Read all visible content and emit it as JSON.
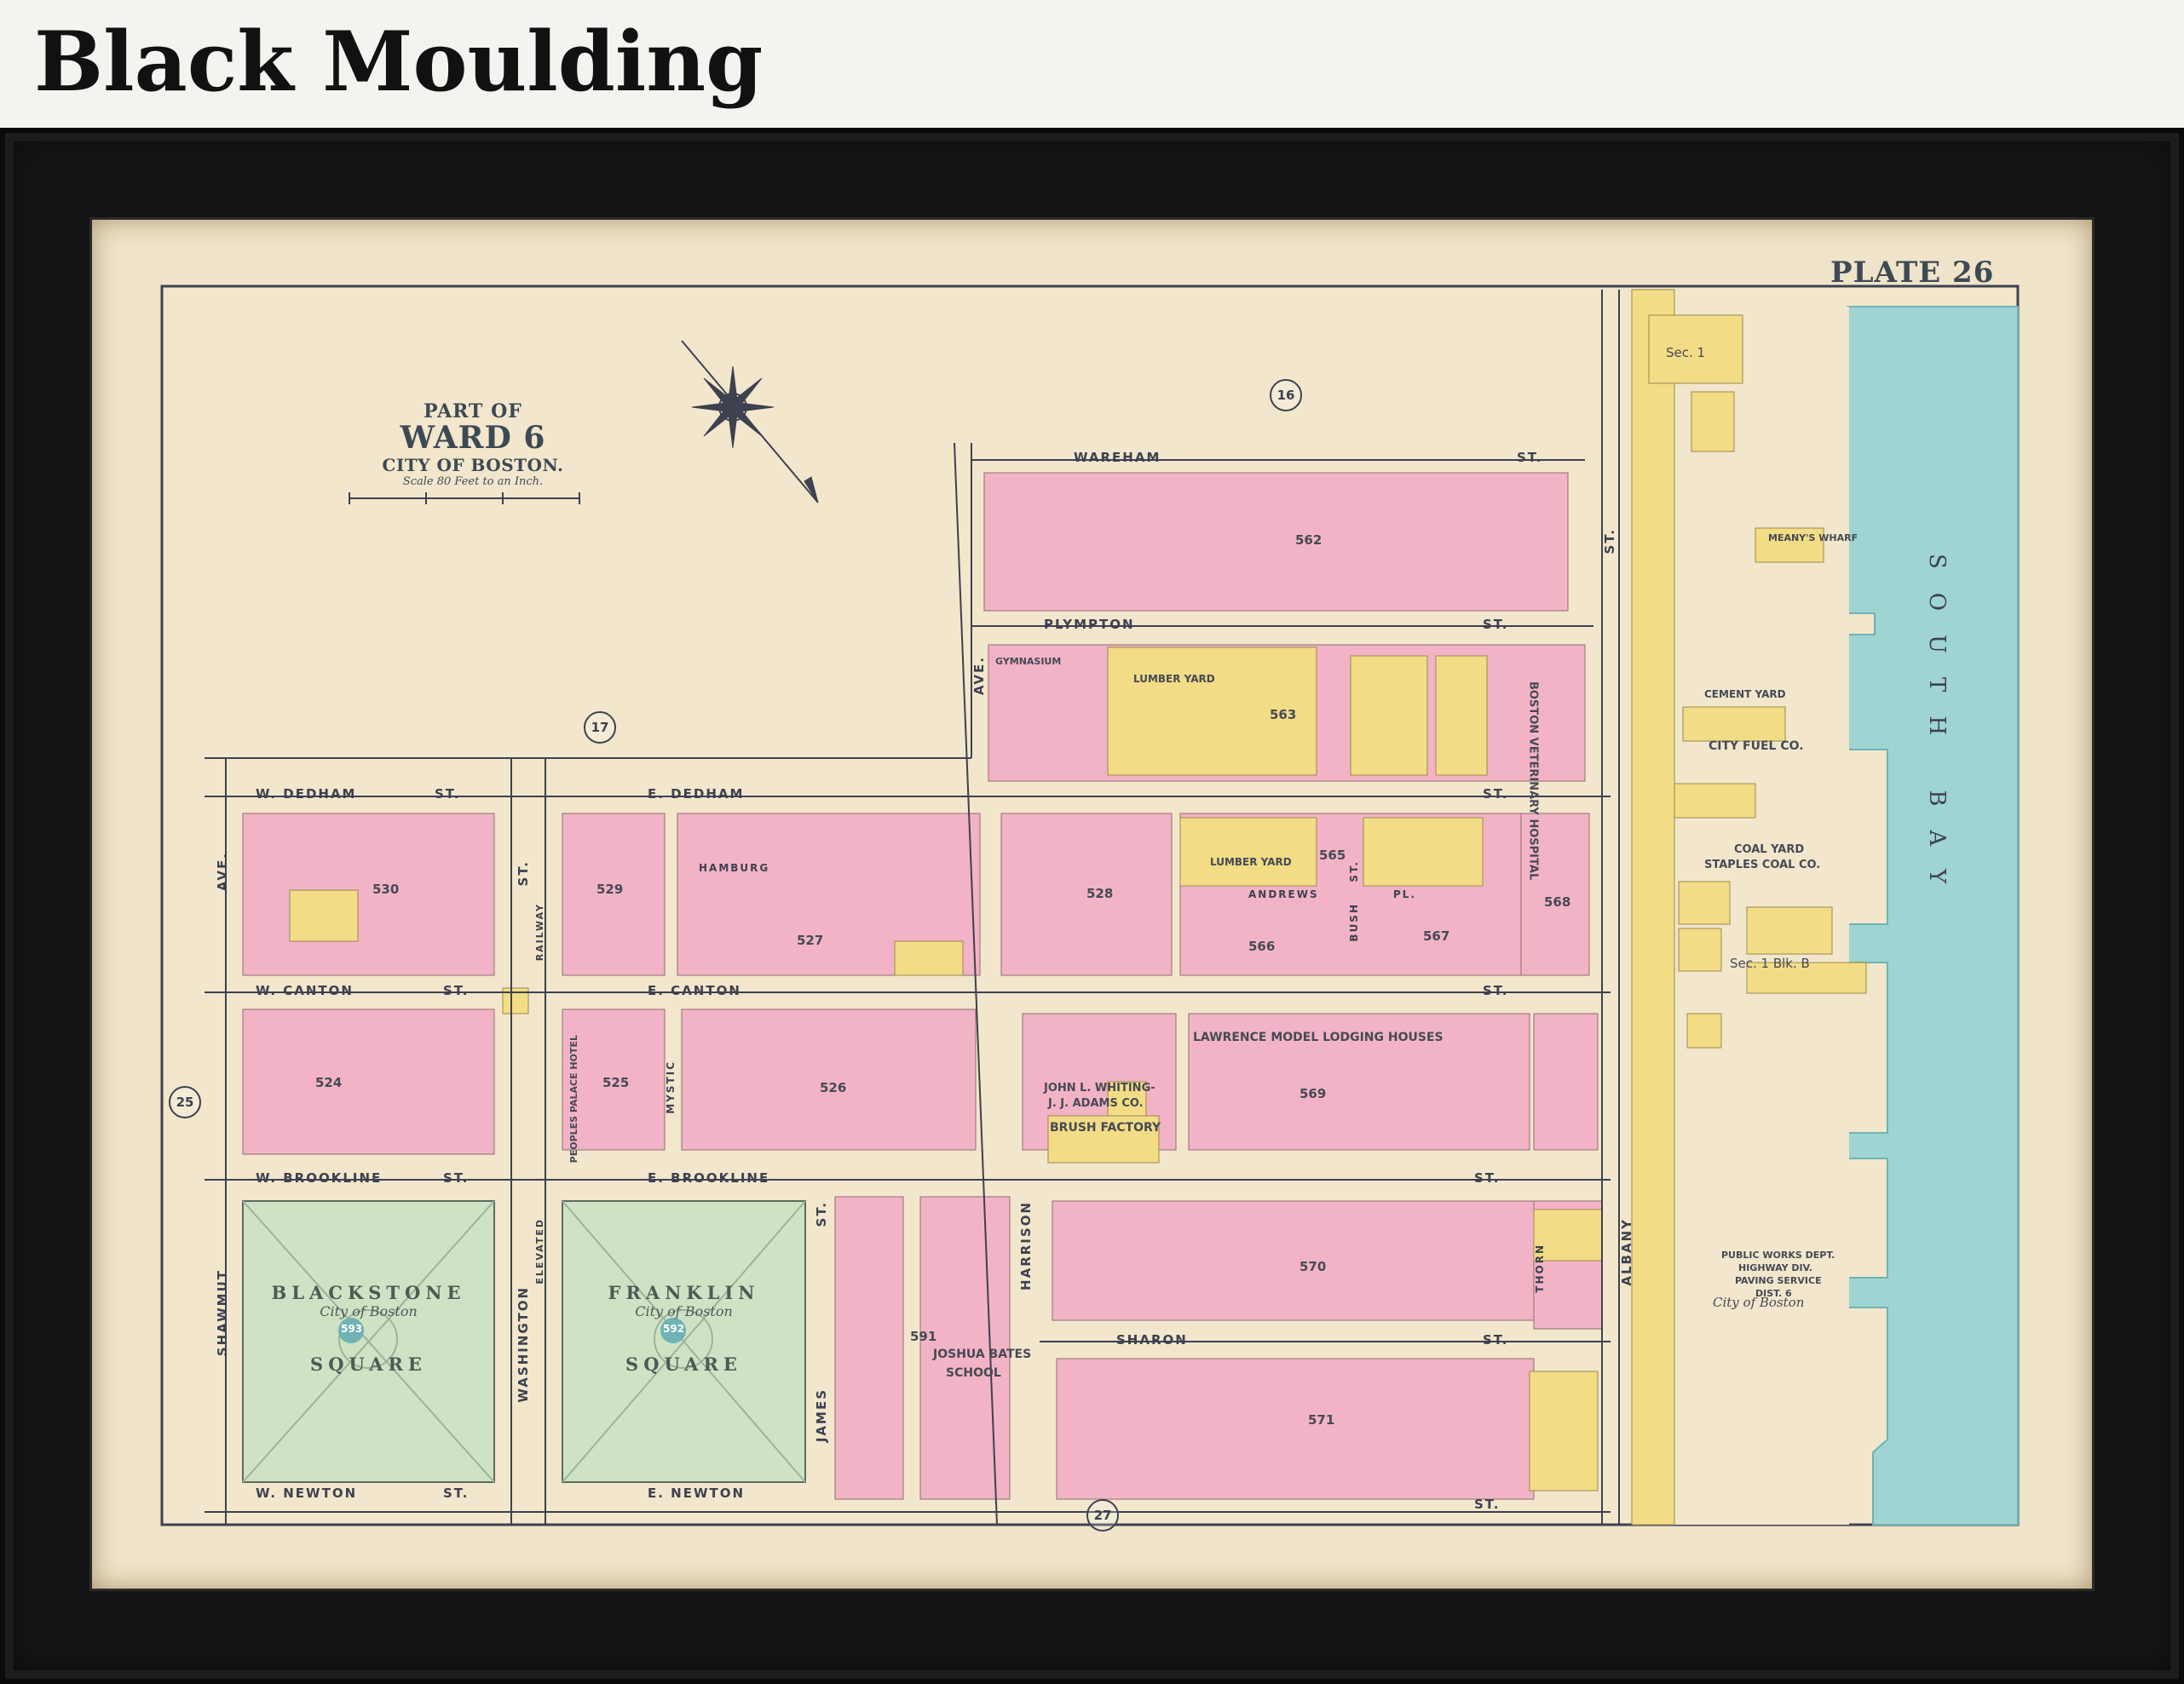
{
  "page": {
    "heading": "Black Moulding"
  },
  "map": {
    "plate": "PLATE 26",
    "title": {
      "line1": "PART OF",
      "line2": "WARD 6",
      "line3": "CITY OF BOSTON.",
      "scale": "Scale 80 Feet to an Inch."
    },
    "wards": [
      "16",
      "17",
      "25",
      "27"
    ],
    "streets": {
      "wareham": "WAREHAM",
      "wareham_st": "ST.",
      "plympton": "PLYMPTON",
      "plympton_st": "ST.",
      "w_dedham": "W. DEDHAM",
      "w_dedham_st": "ST.",
      "e_dedham": "E. DEDHAM",
      "e_dedham_st": "ST.",
      "w_canton": "W. CANTON",
      "w_canton_st": "ST.",
      "e_canton": "E. CANTON",
      "e_canton_st": "ST.",
      "w_brookline": "W. BROOKLINE",
      "w_brookline_st": "ST.",
      "e_brookline": "E. BROOKLINE",
      "e_brookline_st": "ST.",
      "sharon": "SHARON",
      "sharon_st": "ST.",
      "w_newton": "W. NEWTON",
      "w_newton_st": "ST.",
      "e_newton": "E. NEWTON",
      "e_newton_st": "ST.",
      "hamburg": "HAMBURG",
      "andrews": "ANDREWS",
      "andrews_pl": "PL.",
      "shawmut": "SHAWMUT",
      "shawmut_ave": "AVE.",
      "washington": "WASHINGTON",
      "washington_st": "ST.",
      "harrison": "HARRISON",
      "harrison_ave": "AVE.",
      "albany": "ALBANY",
      "albany_st": "ST.",
      "james": "JAMES",
      "james_st": "ST.",
      "mystic": "MYSTIC",
      "thorn": "THORN",
      "bush": "BUSH",
      "bush_st": "ST.",
      "railway": "RAILWAY",
      "elevated": "ELEVATED"
    },
    "squares": {
      "blackstone": {
        "name": "BLACKSTONE",
        "owner": "City of Boston",
        "word": "SQUARE",
        "num": "593"
      },
      "franklin": {
        "name": "FRANKLIN",
        "owner": "City of Boston",
        "word": "SQUARE",
        "num": "592"
      }
    },
    "buildings": {
      "lodging": "LAWRENCE MODEL LODGING HOUSES",
      "whiting": "JOHN L. WHITING-",
      "whiting2": "J. J. ADAMS CO.",
      "brush": "BRUSH FACTORY",
      "school": "JOSHUA BATES",
      "school2": "SCHOOL",
      "hospital": "BOSTON VETERINARY HOSPITAL",
      "lumber1": "LUMBER YARD",
      "lumber2": "LUMBER YARD",
      "coal_yard": "COAL YARD",
      "staples": "STAPLES COAL CO.",
      "city_fuel": "CITY FUEL CO.",
      "cement": "CEMENT YARD",
      "meanys": "MEANY'S WHARF",
      "public_works": "PUBLIC WORKS DEPT.",
      "public_works2": "HIGHWAY DIV.",
      "public_works3": "PAVING SERVICE",
      "public_works4": "DIST. 6",
      "gymnasium": "GYMNASIUM",
      "city_of_boston": "City of Boston",
      "peoples": "PEOPLES PALACE HOTEL",
      "sec1": "Sec. 1",
      "sec1blk": "Sec. 1 Blk. B"
    },
    "blocks": [
      "562",
      "563",
      "565",
      "566",
      "567",
      "568",
      "569",
      "570",
      "571",
      "591",
      "524",
      "525",
      "526",
      "527",
      "528",
      "529",
      "530"
    ],
    "water": "SOUTH BAY"
  },
  "colors": {
    "pink": "#f3b3c6",
    "yellow": "#f2dc85",
    "green": "#cfe2c4",
    "water": "#9ed4d2",
    "street": "#f6e9cf",
    "paper": "#efe3c9"
  }
}
